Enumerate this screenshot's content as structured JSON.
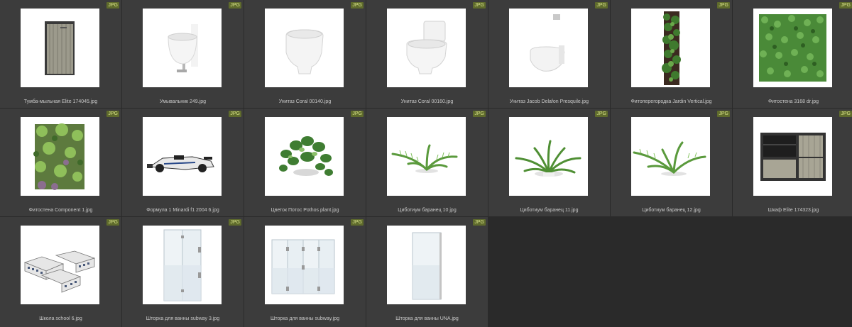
{
  "badge_label": "JPG",
  "colors": {
    "background": "#2a2a2a",
    "tile": "#3c3c3c",
    "badge_bg": "#5f6b2c",
    "badge_text": "#d9e38a"
  },
  "files": [
    {
      "name": "Тумба-мыльная Elite 174045.jpg",
      "icon": "cabinet-thumbnail"
    },
    {
      "name": "Умывальник 249.jpg",
      "icon": "sink-thumbnail"
    },
    {
      "name": "Унитаз Coral 00140.jpg",
      "icon": "toilet-thumbnail"
    },
    {
      "name": "Унитаз Coral 00160.jpg",
      "icon": "toilet-tank-thumbnail"
    },
    {
      "name": "Унитаз Jacob Delafon Presquile.jpg",
      "icon": "wall-toilet-thumbnail"
    },
    {
      "name": "Фитоперегородка Jardin Vertical.jpg",
      "icon": "vertical-garden-thumbnail"
    },
    {
      "name": "Фитостена 3168 dr.jpg",
      "icon": "green-wall-thumbnail"
    },
    {
      "name": "Фитостена Component 1.jpg",
      "icon": "green-wall-component-thumbnail"
    },
    {
      "name": "Формула 1 Minardi f1 2004 6.jpg",
      "icon": "race-car-thumbnail"
    },
    {
      "name": "Цветок Потос Pothos plant.jpg",
      "icon": "pothos-plant-thumbnail"
    },
    {
      "name": "Циботиум баранец 10.jpg",
      "icon": "fern-thumbnail"
    },
    {
      "name": "Циботиум баранец 11.jpg",
      "icon": "fern-thumbnail"
    },
    {
      "name": "Циботиум баранец 12.jpg",
      "icon": "fern-thumbnail"
    },
    {
      "name": "Шкаф Elite 174323.jpg",
      "icon": "wardrobe-thumbnail"
    },
    {
      "name": "Школа school 6.jpg",
      "icon": "school-building-thumbnail"
    },
    {
      "name": "Шторка для ванны subway 3.jpg",
      "icon": "shower-screen-thumbnail"
    },
    {
      "name": "Шторка для ванны subway.jpg",
      "icon": "shower-screen-wide-thumbnail"
    },
    {
      "name": "Шторка для ванны UNA.jpg",
      "icon": "shower-panel-thumbnail"
    }
  ]
}
